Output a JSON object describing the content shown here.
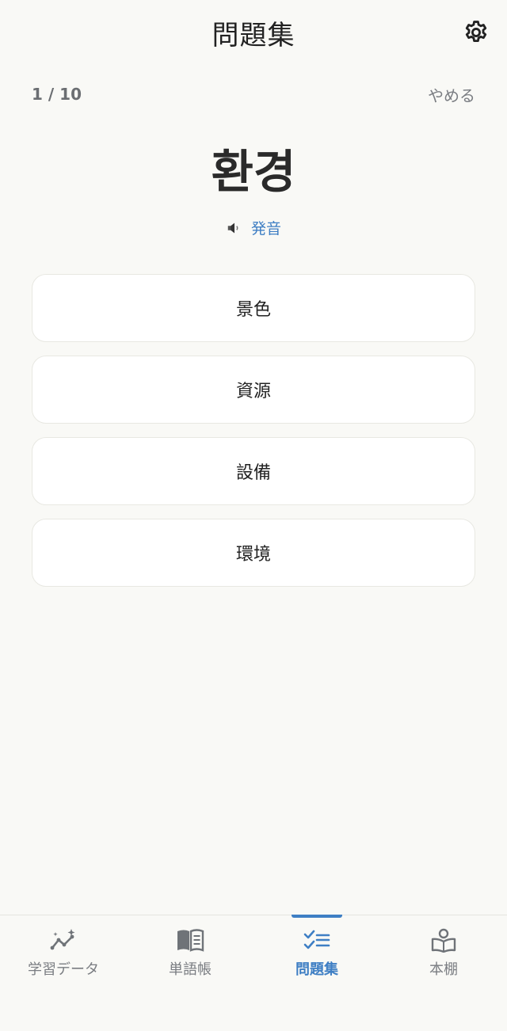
{
  "header": {
    "title": "問題集"
  },
  "quiz": {
    "progress": "1 / 10",
    "quit_label": "やめる",
    "word": "환경",
    "pronounce_label": "発音",
    "options": [
      "景色",
      "資源",
      "設備",
      "環境"
    ]
  },
  "tabs": [
    {
      "label": "学習データ",
      "icon": "chart-sparkle-icon",
      "active": false
    },
    {
      "label": "単語帳",
      "icon": "open-book-icon",
      "active": false
    },
    {
      "label": "問題集",
      "icon": "checklist-icon",
      "active": true
    },
    {
      "label": "本棚",
      "icon": "reader-icon",
      "active": false
    }
  ],
  "colors": {
    "accent": "#3f7fc4",
    "background": "#f9f9f6",
    "muted": "#7a7d82"
  }
}
